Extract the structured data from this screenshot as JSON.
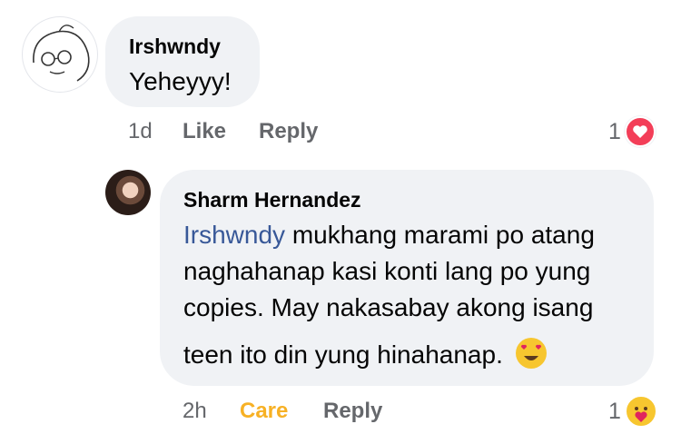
{
  "comments": [
    {
      "author": "Irshwndy",
      "text": "Yeheyyy!",
      "time": "1d",
      "action1": "Like",
      "action2": "Reply",
      "reaction_count": "1",
      "reaction_icon": "heart-reaction-icon"
    },
    {
      "author": "Sharm Hernandez",
      "mention": "Irshwndy",
      "text_line1_rest": " mukhang marami po atang",
      "text_line2": "naghahanap kasi konti lang po yung",
      "text_line3": "copies. May nakasabay akong isang",
      "text_line4": "teen ito din yung hinahanap.",
      "time": "2h",
      "action1": "Care",
      "action2": "Reply",
      "reaction_count": "1",
      "reaction_icon": "care-reaction-icon"
    }
  ],
  "colors": {
    "bubble": "#f0f2f5",
    "mention": "#385898",
    "meta": "#65676b",
    "care": "#f7b125",
    "heart": "#f33e58"
  }
}
